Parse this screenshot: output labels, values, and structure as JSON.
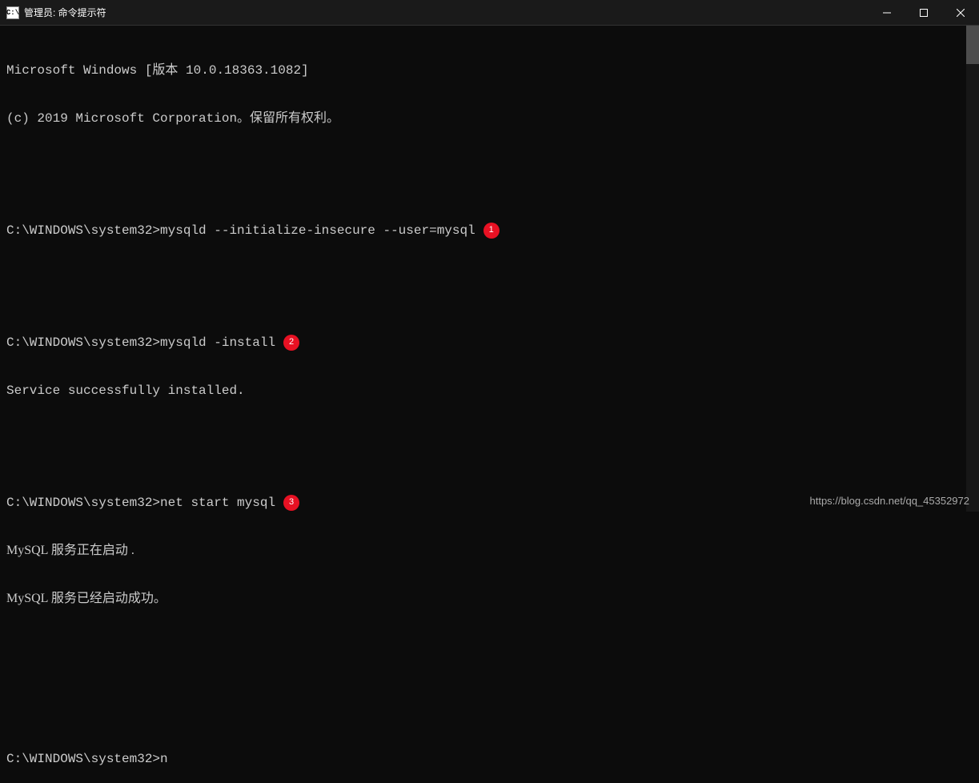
{
  "titlebar": {
    "icon_text": "C:\\",
    "title": "管理员: 命令提示符"
  },
  "terminal": {
    "header1": "Microsoft Windows [版本 10.0.18363.1082]",
    "header2": "(c) 2019 Microsoft Corporation。保留所有权利。",
    "block1": {
      "prompt": "C:\\WINDOWS\\system32>",
      "cmd": "mysqld --initialize-insecure --user=mysql",
      "badge": "1"
    },
    "block2": {
      "prompt": "C:\\WINDOWS\\system32>",
      "cmd": "mysqld -install",
      "badge": "2",
      "out1": "Service successfully installed."
    },
    "block3": {
      "prompt": "C:\\WINDOWS\\system32>",
      "cmd": "net start mysql",
      "badge": "3",
      "out1": "MySQL 服务正在启动 .",
      "out2": "MySQL 服务已经启动成功。"
    },
    "block4": {
      "prompt": "C:\\WINDOWS\\system32>",
      "input": "n"
    }
  },
  "watermark": "https://blog.csdn.net/qq_45352972"
}
